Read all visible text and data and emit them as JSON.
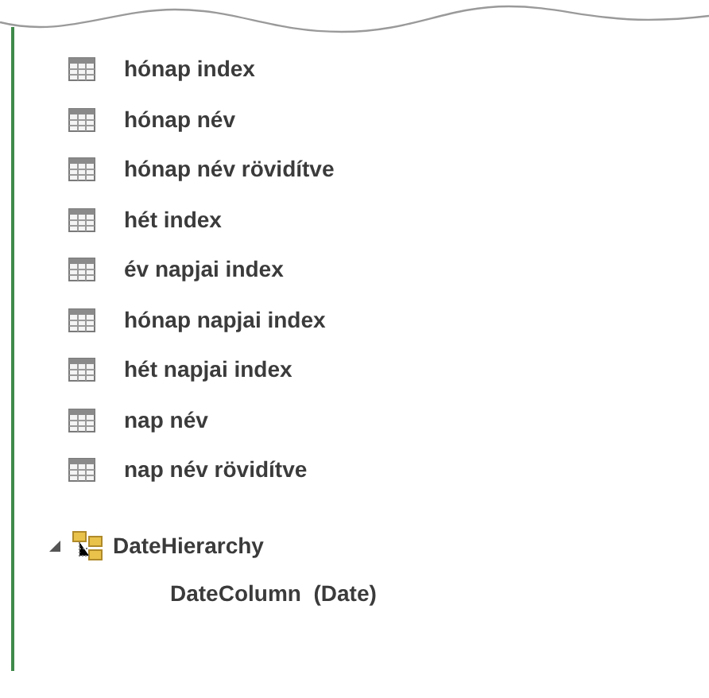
{
  "fields": [
    {
      "label": "hónap index"
    },
    {
      "label": "hónap név"
    },
    {
      "label": "hónap név rövidítve"
    },
    {
      "label": "hét index"
    },
    {
      "label": "év napjai index"
    },
    {
      "label": "hónap napjai index"
    },
    {
      "label": "hét napjai index"
    },
    {
      "label": "nap név"
    },
    {
      "label": "nap név rövidítve"
    }
  ],
  "hierarchy": {
    "label": "DateHierarchy",
    "expanded": true,
    "levels": [
      {
        "label": "DateColumn  (Date)"
      }
    ]
  }
}
